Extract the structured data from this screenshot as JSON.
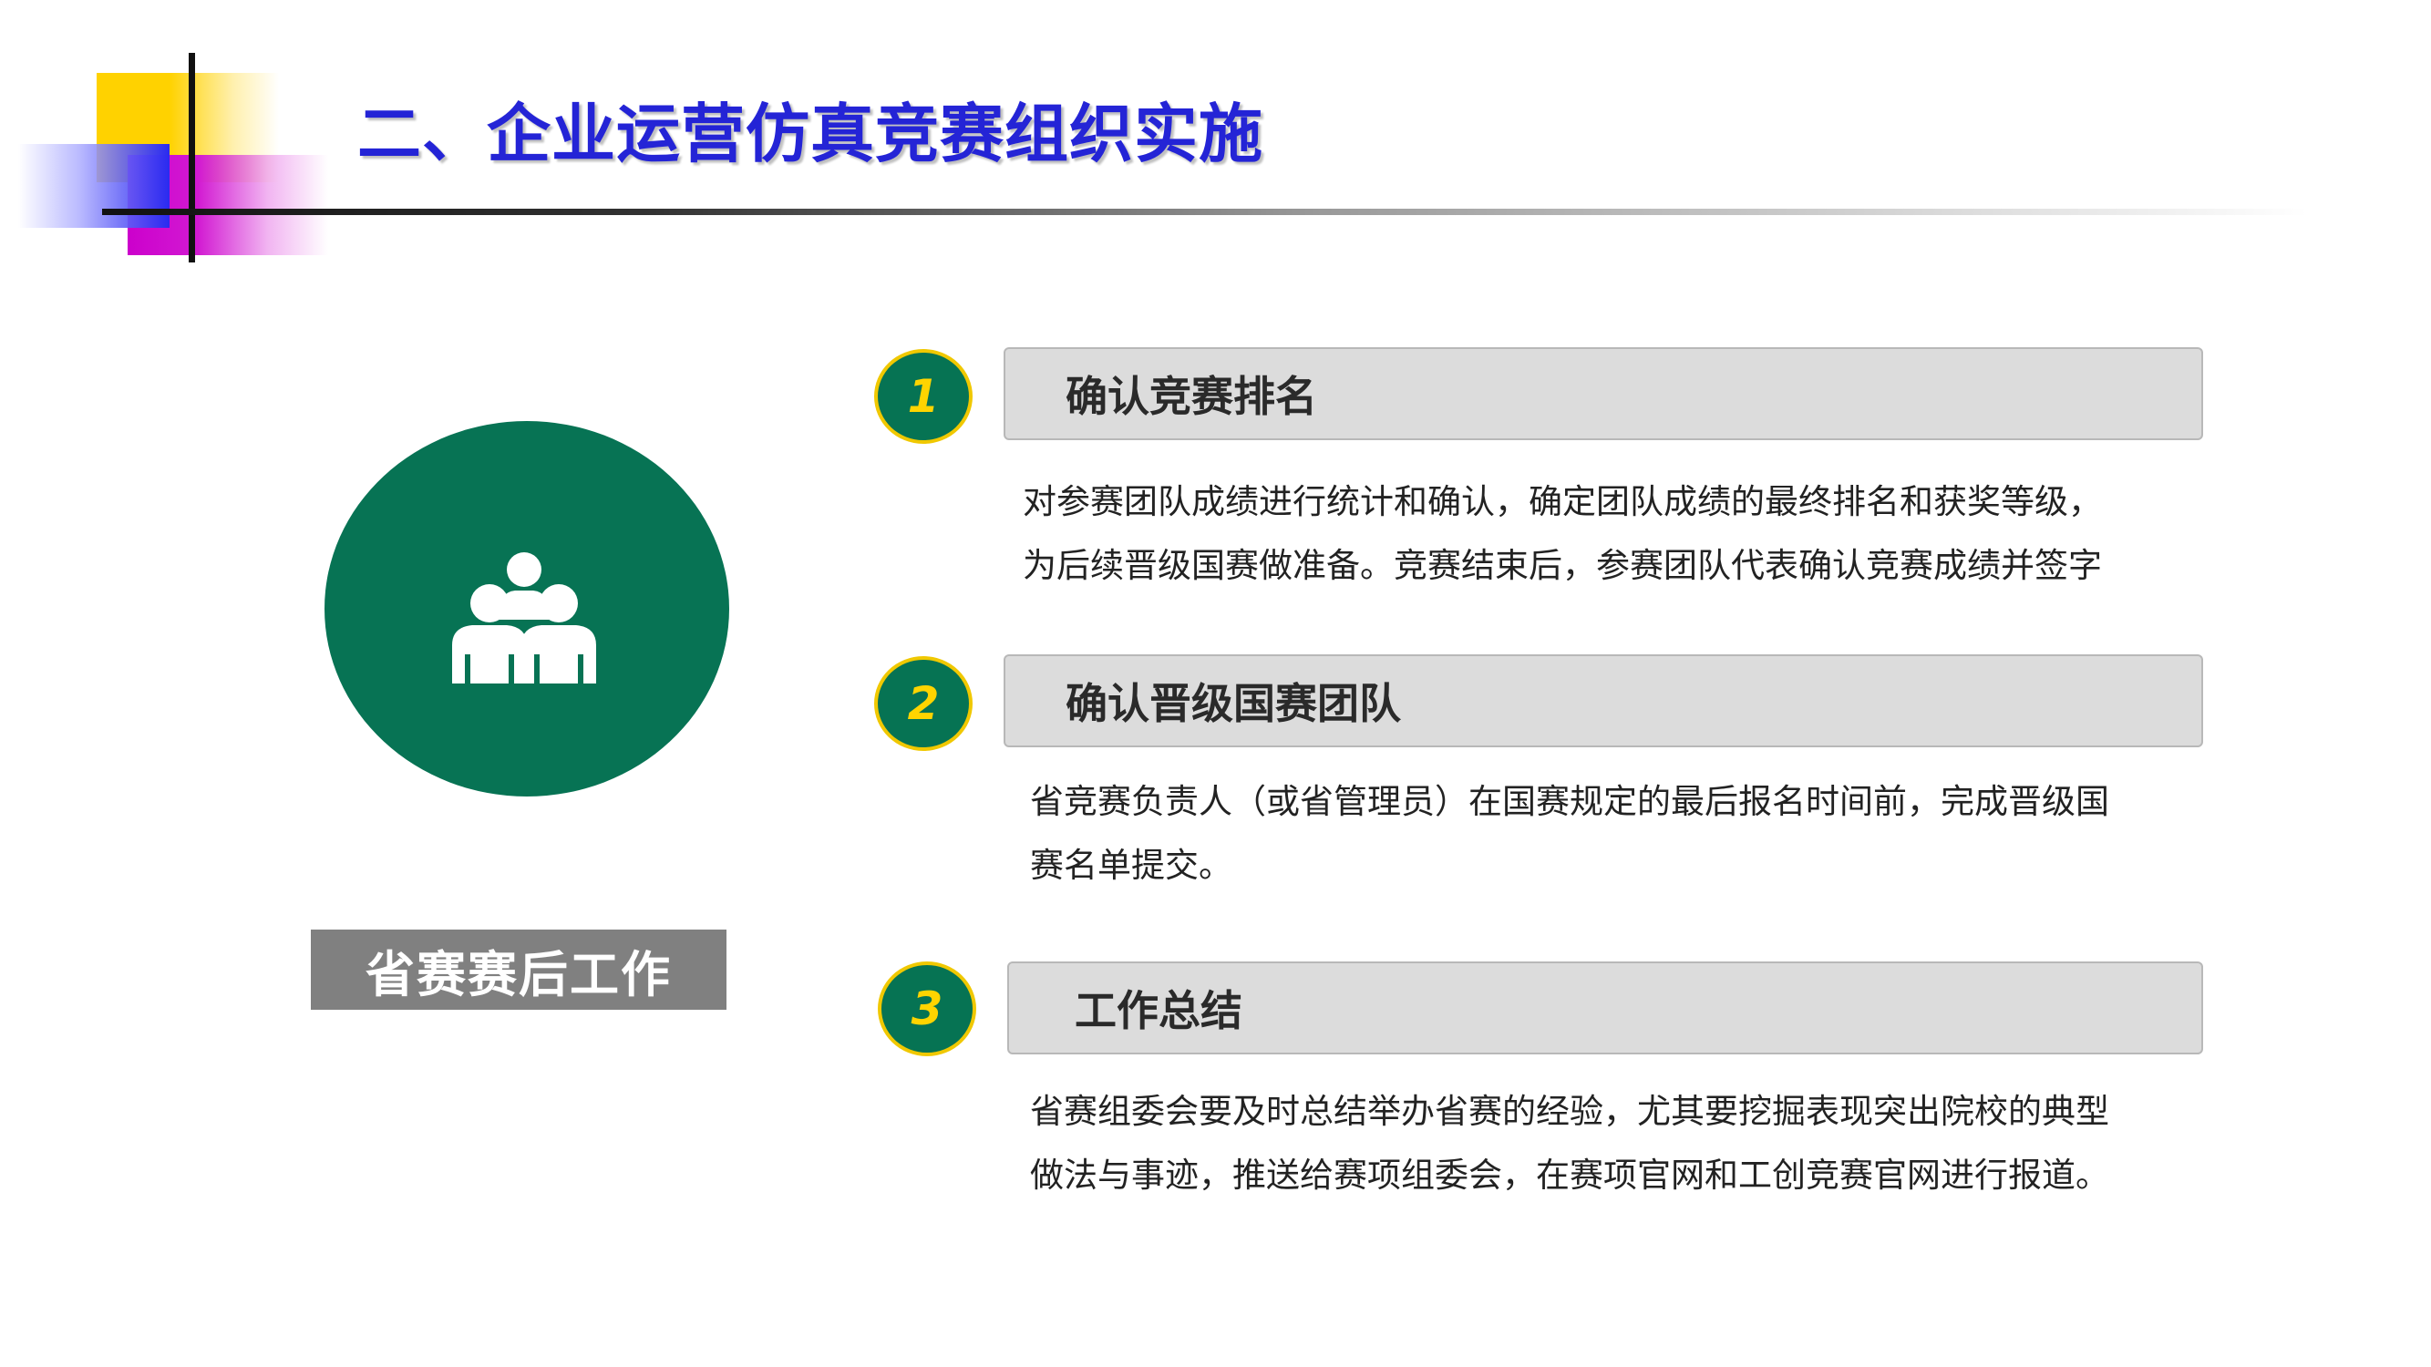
{
  "header": {
    "title": "二、企业运营仿真竞赛组织实施"
  },
  "left": {
    "icon": "team-icon",
    "label": "省赛赛后工作"
  },
  "colors": {
    "title": "#2424d6",
    "circle_green": "#077354",
    "number_yellow": "#ffd400",
    "bar_gray": "#dcdcdc",
    "label_gray": "#808080"
  },
  "steps": [
    {
      "number": "1",
      "title": "确认竞赛排名",
      "lines": [
        "对参赛团队成绩进行统计和确认，确定团队成绩的最终排名和获奖等级，",
        "为后续晋级国赛做准备。竞赛结束后，参赛团队代表确认竞赛成绩并签字"
      ]
    },
    {
      "number": "2",
      "title": "确认晋级国赛团队",
      "lines": [
        "省竞赛负责人（或省管理员）在国赛规定的最后报名时间前，完成晋级国",
        "赛名单提交。"
      ]
    },
    {
      "number": "3",
      "title": "工作总结",
      "lines": [
        "省赛组委会要及时总结举办省赛的经验，尤其要挖掘表现突出院校的典型",
        "做法与事迹，推送给赛项组委会，在赛项官网和工创竞赛官网进行报道。"
      ]
    }
  ]
}
